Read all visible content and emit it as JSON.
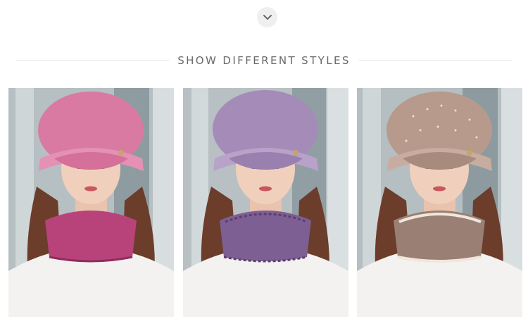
{
  "section": {
    "title": "SHOW DIFFERENT STYLES"
  },
  "icons": {
    "scroll": "chevron-down-icon"
  },
  "products": [
    {
      "style": "pink",
      "hat_color": "#d97aa3",
      "scarf_color": "#b8437a"
    },
    {
      "style": "purple",
      "hat_color": "#a48bb8",
      "scarf_color": "#7d5f93"
    },
    {
      "style": "beige",
      "hat_color": "#b79a8c",
      "scarf_color": "#9a7f74"
    }
  ]
}
